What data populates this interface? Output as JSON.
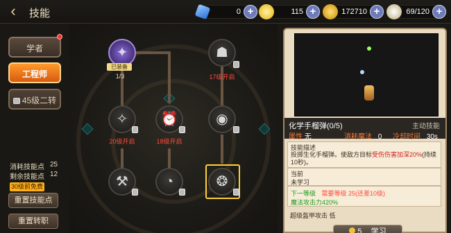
{
  "header": {
    "title": "技能",
    "back_icon": "back-arrow-icon"
  },
  "resources": {
    "gem": {
      "value": "0",
      "icon": "blue-gem-icon",
      "color": "#4a8cf0"
    },
    "spin": {
      "value": "115",
      "icon": "swirl-icon",
      "color": "#f0c020"
    },
    "gold": {
      "value": "172710",
      "icon": "gold-coin-icon",
      "color": "#f2b318"
    },
    "stamina": {
      "value": "69/120",
      "icon": "wing-icon",
      "color": "#d8c8a0"
    }
  },
  "sidebar": {
    "tabs": [
      {
        "label": "学者"
      },
      {
        "label": "工程师"
      },
      {
        "label": "45级二转"
      }
    ],
    "points": [
      {
        "label": "消耗技能点",
        "value": "25"
      },
      {
        "label": "剩余技能点",
        "value": "12"
      }
    ],
    "free_badge": "30级前免费",
    "reset_skill": "重置技能点",
    "reset_job": "重置转职"
  },
  "tree": {
    "equipped_badge": "已装备",
    "level_text": "1/3",
    "nodes": [
      {
        "label": "",
        "icon": "crystal-skill-icon"
      },
      {
        "label": "17级开启",
        "icon": "figure-skill-icon"
      },
      {
        "label": "20级开启",
        "icon": "sparkle-skill-icon"
      },
      {
        "label": "18级开启",
        "icon": "alarm-skill-icon"
      },
      {
        "label": "",
        "icon": "swirl-orb-skill-icon"
      },
      {
        "label": "",
        "icon": "tools-skill-icon"
      },
      {
        "label": "",
        "icon": "clock-skill-icon"
      },
      {
        "label": "",
        "icon": "grenade-skill-icon"
      }
    ]
  },
  "detail": {
    "name": "化学手榴弹(0/5)",
    "type": "主动技能",
    "attribute_label": "属性",
    "attribute_value": "无",
    "mana_label": "消耗魔法",
    "mana_value": "0",
    "cooldown_label": "冷却时间",
    "cooldown_value": "30s",
    "desc_title": "技能描述",
    "desc_text_a": "投掷生化手榴弹。使敌方目标",
    "desc_text_b": "受伤伤害加深20%",
    "desc_text_c": "(持续10秒)。",
    "current_label": "当前",
    "current_value": "未学习",
    "next_label": "下一等级",
    "next_requirement": "需要等级 25(还差10级)",
    "next_effect": "魔法攻击力420%",
    "extra": "超级盔甲攻击 低",
    "learn_cost": "5",
    "learn_label": "学习"
  }
}
